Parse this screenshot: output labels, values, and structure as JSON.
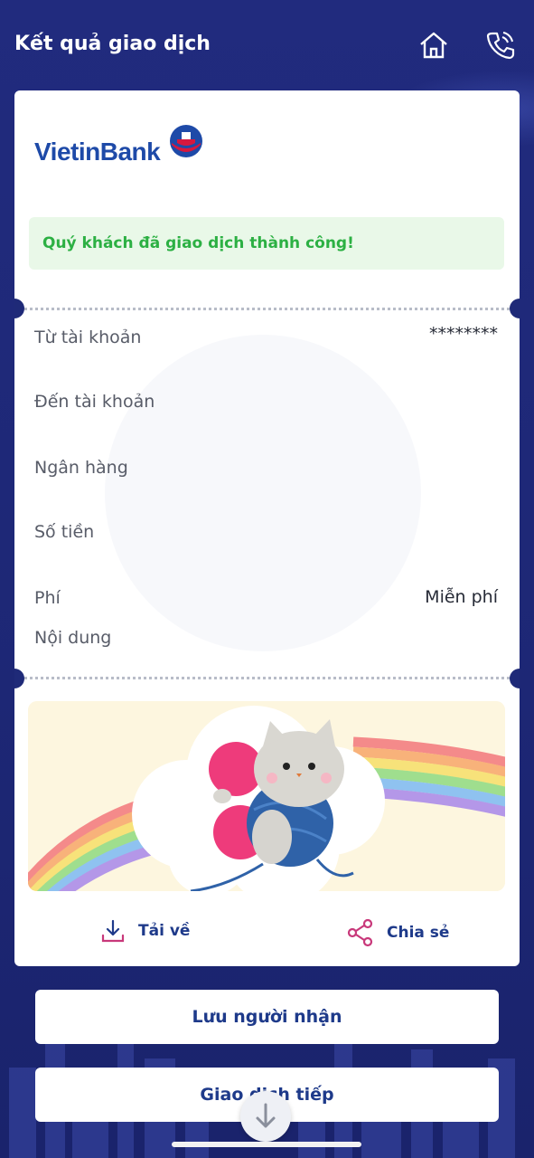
{
  "header": {
    "title": "Kết quả giao dịch"
  },
  "receipt": {
    "bank_logo_text": "VietinBank",
    "success_message": "Quý khách đã giao dịch thành công!",
    "rows": [
      {
        "label": "Từ tài khoản",
        "value": "********"
      },
      {
        "label": "Đến tài khoản",
        "value": ""
      },
      {
        "label": "Ngân hàng",
        "value": ""
      },
      {
        "label": "Số tiền",
        "value": ""
      },
      {
        "label": "Phí",
        "value": "Miễn phí"
      },
      {
        "label": "Nội dung",
        "value": ""
      }
    ],
    "actions": {
      "download": "Tải về",
      "share": "Chia sẻ"
    }
  },
  "buttons": {
    "save_recipient": "Lưu người nhận",
    "next_transaction": "Giao dịch tiếp"
  },
  "colors": {
    "background": "#1f2a78",
    "success_bg": "#e9f8e8",
    "success_text": "#2cb043",
    "brand_blue": "#1e4aa8",
    "brand_red": "#d6183f",
    "accent_pink": "#c8387a"
  }
}
